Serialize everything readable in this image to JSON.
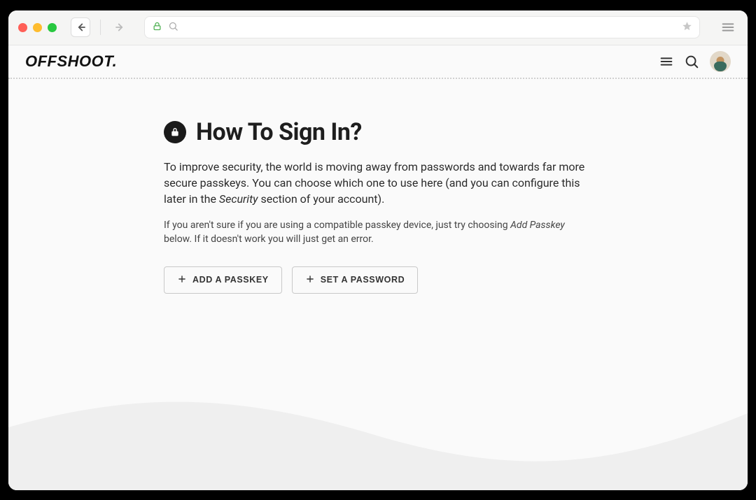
{
  "brand": "OFFSHOOT.",
  "title": "How To Sign In?",
  "paragraph_before_em": "To improve security, the world is moving away from passwords and towards far more secure passkeys. You can choose which one to use here (and you can configure this later in the ",
  "paragraph_em": "Security",
  "paragraph_after_em": " section of your account).",
  "hint_before_em": "If you aren't sure if you are using a compatible passkey device, just try choosing ",
  "hint_em": "Add Passkey",
  "hint_after_em": " below. If it doesn't work you will just get an error.",
  "buttons": {
    "add_passkey": "ADD A PASSKEY",
    "set_password": "SET A PASSWORD"
  }
}
